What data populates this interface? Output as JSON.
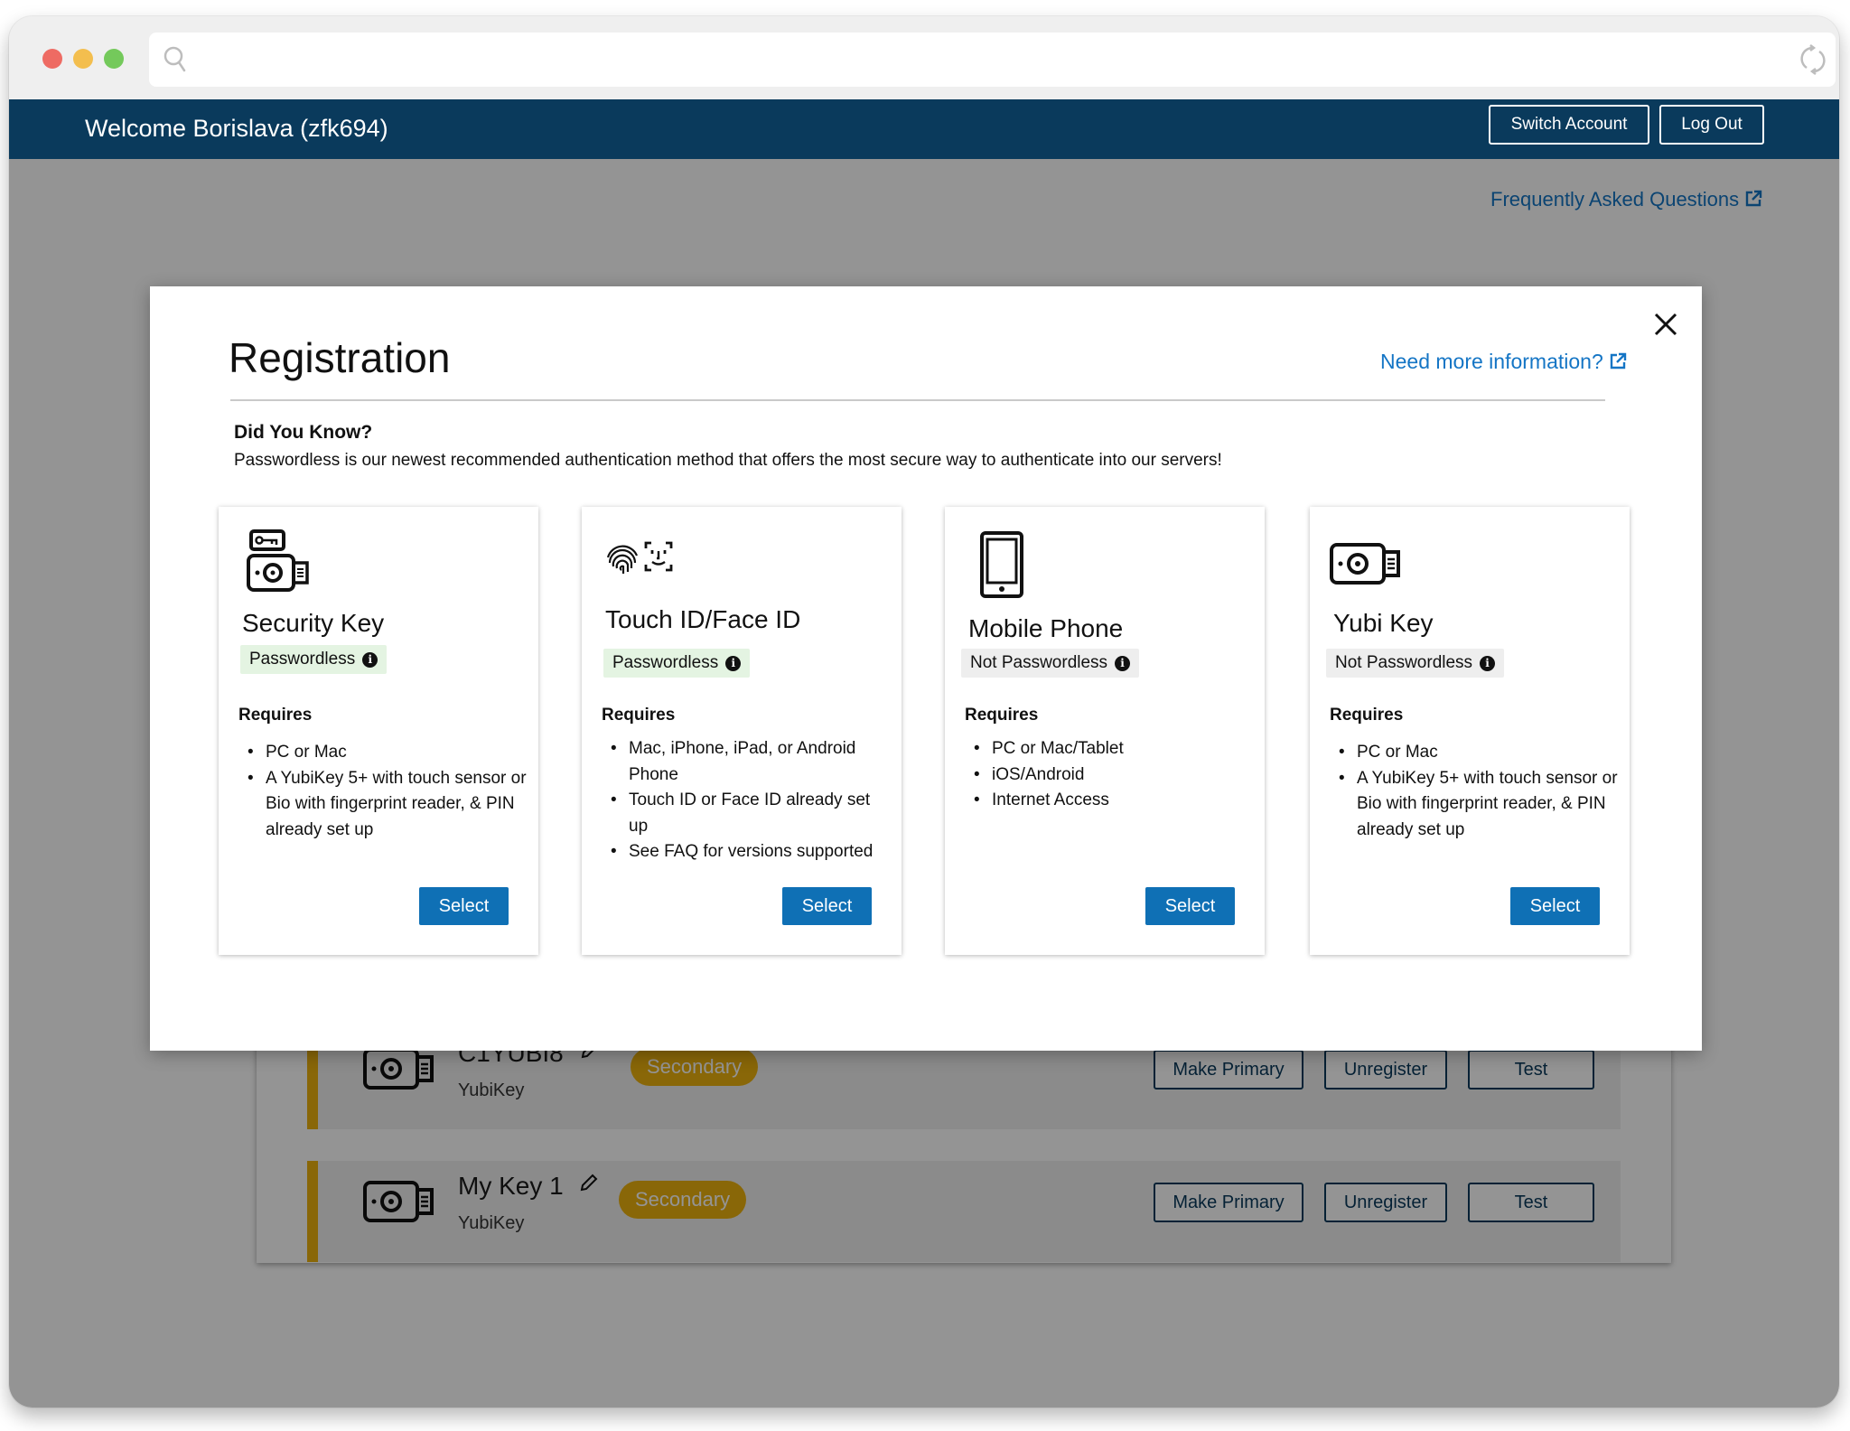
{
  "header": {
    "welcome": "Welcome Borislava (zfk694)",
    "switch_account": "Switch Account",
    "log_out": "Log Out"
  },
  "faq_link": "Frequently Asked Questions",
  "devices": [
    {
      "name": "C1YUBI8",
      "type": "YubiKey",
      "status": "Secondary",
      "make_primary": "Make Primary",
      "unregister": "Unregister",
      "test": "Test"
    },
    {
      "name": "My Key 1",
      "type": "YubiKey",
      "status": "Secondary",
      "make_primary": "Make Primary",
      "unregister": "Unregister",
      "test": "Test"
    }
  ],
  "modal": {
    "title": "Registration",
    "more_info": "Need more information?",
    "did_you_know_title": "Did You Know?",
    "did_you_know_text": "Passwordless is our newest recommended authentication method that offers the most secure way to authenticate into our servers!",
    "cards": [
      {
        "icon": "security-key-icon",
        "title": "Security Key",
        "badge": "Passwordless",
        "requires": "Requires",
        "items": [
          "PC or Mac",
          "A YubiKey 5+ with touch sensor or Bio with fingerprint reader, & PIN already set up"
        ],
        "select": "Select"
      },
      {
        "icon": "fingerprint-face-id-icon",
        "title": "Touch ID/Face ID",
        "badge": "Passwordless",
        "requires": "Requires",
        "items": [
          "Mac, iPhone, iPad, or Android Phone",
          "Touch ID or Face ID already set up",
          "See FAQ for versions supported"
        ],
        "select": "Select"
      },
      {
        "icon": "mobile-phone-icon",
        "title": "Mobile Phone",
        "badge": "Not Passwordless",
        "requires": "Requires",
        "items": [
          "PC or Mac/Tablet",
          "iOS/Android",
          "Internet Access"
        ],
        "select": "Select"
      },
      {
        "icon": "yubikey-icon",
        "title": "Yubi Key",
        "badge": "Not Passwordless",
        "requires": "Requires",
        "items": [
          "PC or Mac",
          "A YubiKey 5+ with touch sensor or Bio with fingerprint reader, & PIN already set up"
        ],
        "select": "Select"
      }
    ]
  },
  "colors": {
    "header_bg": "#0a3a5c",
    "link": "#1475c5",
    "primary_button": "#0f70b5",
    "secondary_badge": "#ecb20f",
    "passwordless_badge_bg": "#e4f4e2",
    "not_passwordless_badge_bg": "#eeeeee"
  }
}
